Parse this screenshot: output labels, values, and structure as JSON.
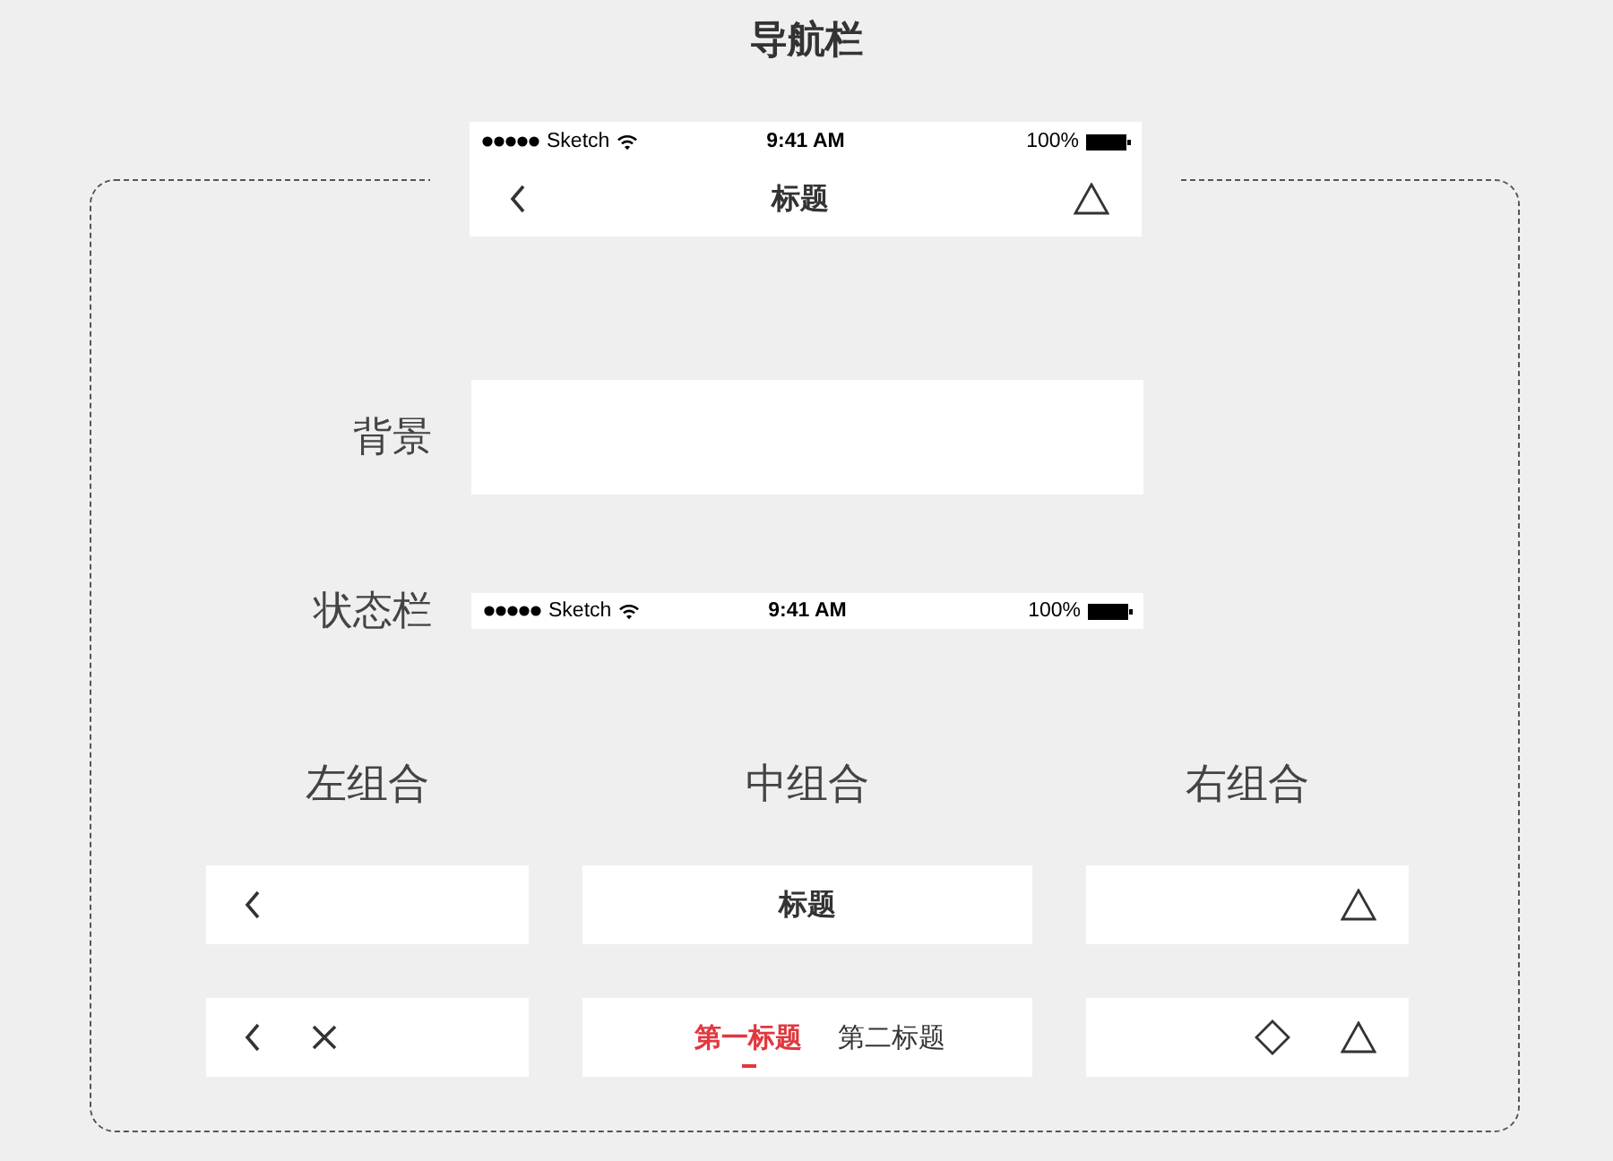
{
  "page_title": "导航栏",
  "preview": {
    "status_bar": {
      "carrier": "Sketch",
      "time": "9:41 AM",
      "battery": "100%"
    },
    "nav": {
      "title": "标题"
    }
  },
  "rows": [
    {
      "label": "背景",
      "kind": "background"
    },
    {
      "label": "状态栏",
      "kind": "status_bar",
      "status_bar": {
        "carrier": "Sketch",
        "time": "9:41 AM",
        "battery": "100%"
      }
    }
  ],
  "groups": [
    {
      "heading": "左组合",
      "variants": [
        {
          "items": [
            {
              "kind": "back"
            }
          ]
        },
        {
          "items": [
            {
              "kind": "back"
            },
            {
              "kind": "close"
            }
          ]
        }
      ]
    },
    {
      "heading": "中组合",
      "variants": [
        {
          "items": [
            {
              "kind": "title",
              "text": "标题"
            }
          ]
        },
        {
          "items": [
            {
              "kind": "tabs",
              "tabs": [
                {
                  "label": "第一标题",
                  "selected": true
                },
                {
                  "label": "第二标题",
                  "selected": false
                }
              ]
            }
          ]
        }
      ]
    },
    {
      "heading": "右组合",
      "variants": [
        {
          "items": [
            {
              "kind": "triangle"
            }
          ]
        },
        {
          "items": [
            {
              "kind": "diamond"
            },
            {
              "kind": "triangle"
            }
          ]
        }
      ]
    }
  ]
}
